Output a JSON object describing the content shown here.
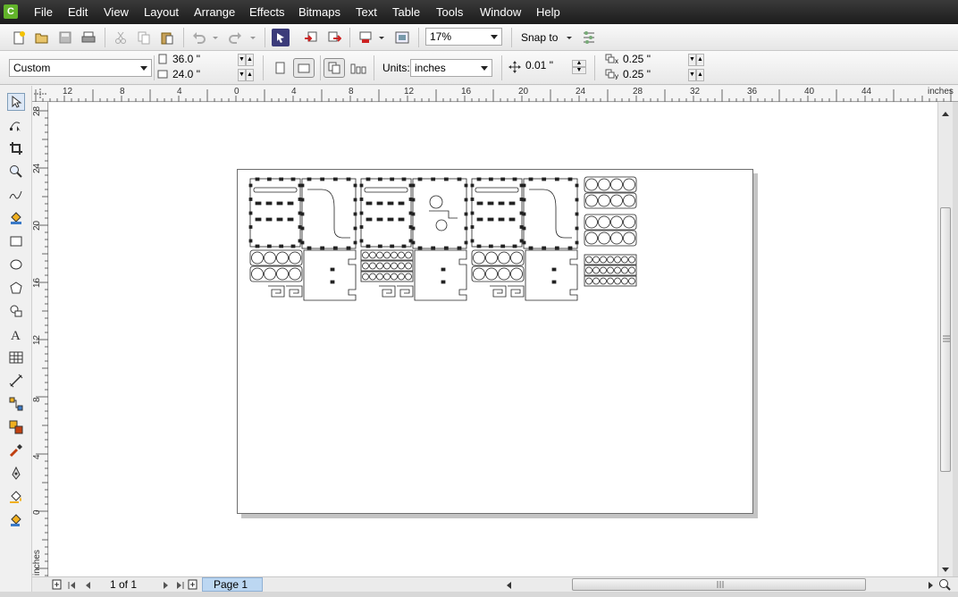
{
  "menu": [
    "File",
    "Edit",
    "View",
    "Layout",
    "Arrange",
    "Effects",
    "Bitmaps",
    "Text",
    "Table",
    "Tools",
    "Window",
    "Help"
  ],
  "toolbar1": {
    "zoom": "17%",
    "snap_to": "Snap to"
  },
  "toolbar2": {
    "page_preset": "Custom",
    "page_width": "36.0 \"",
    "page_height": "24.0 \"",
    "units_label": "Units:",
    "units_value": "inches",
    "nudge": "0.01 \"",
    "dup_x": "0.25 \"",
    "dup_y": "0.25 \""
  },
  "ruler": {
    "h_labels": [
      "12",
      "8",
      "4",
      "0",
      "4",
      "8",
      "12",
      "16",
      "20",
      "24",
      "28",
      "32",
      "36",
      "40",
      "44"
    ],
    "h_unit": "inches",
    "v_labels": [
      "28",
      "24",
      "20",
      "16",
      "12",
      "8",
      "4",
      "0"
    ],
    "v_unit": "inches"
  },
  "page_nav": {
    "counter": "1 of 1",
    "tab_label": "Page 1"
  },
  "icons": [
    "pick-tool-icon",
    "shape-tool-icon",
    "crop-tool-icon",
    "zoom-tool-icon",
    "freehand-tool-icon",
    "smart-fill-icon",
    "rectangle-tool-icon",
    "ellipse-tool-icon",
    "polygon-tool-icon",
    "basic-shapes-icon",
    "text-tool-icon",
    "table-tool-icon",
    "dimension-tool-icon",
    "connector-tool-icon",
    "blend-tool-icon",
    "eyedropper-icon",
    "outline-pen-icon",
    "fill-tool-icon",
    "interactive-fill-icon"
  ]
}
